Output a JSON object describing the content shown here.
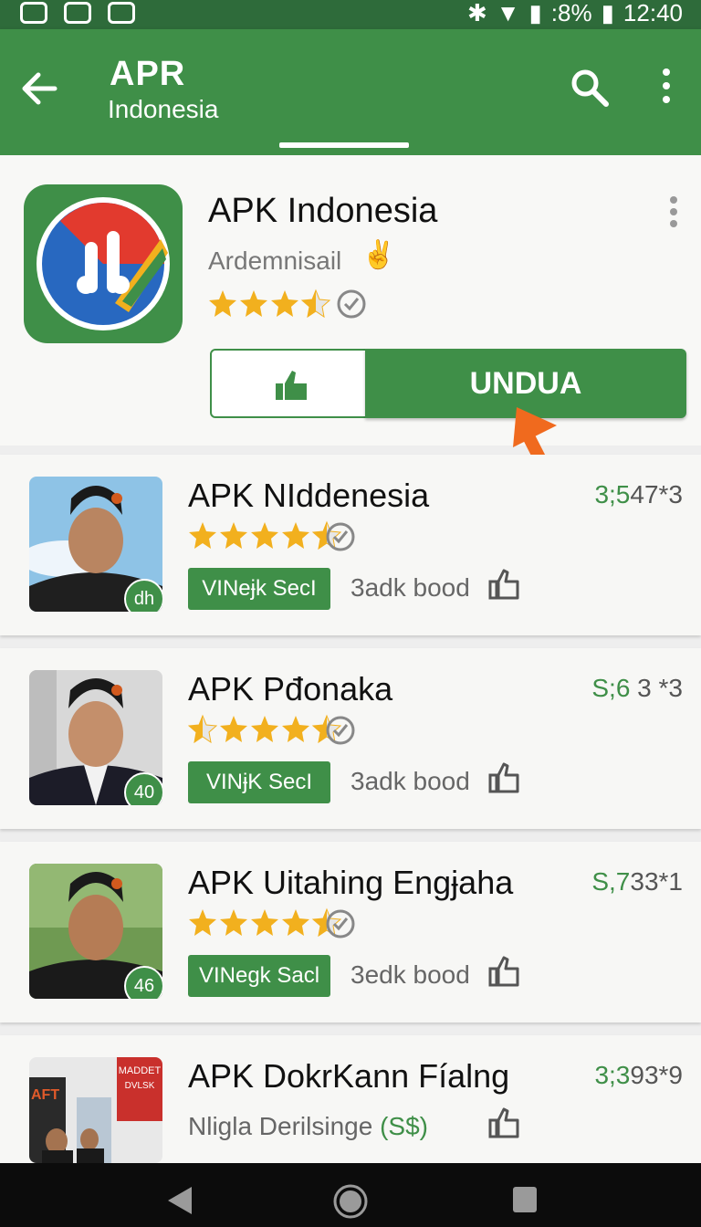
{
  "status_bar": {
    "battery": ":8%",
    "time": "12:40"
  },
  "app_bar": {
    "title": "APR",
    "subtitle": "Indonesia"
  },
  "featured": {
    "title": "APK Indonesia",
    "developer": "Ardemnisail",
    "rating": 3.5,
    "download_label": "UNDUA"
  },
  "apps": [
    {
      "title": "APK NIddenesia",
      "price": "3;547*3",
      "price_green": "3;5",
      "price_rest": "47*3",
      "rating": 4.5,
      "chip": "VINeɉk SecI",
      "meta": "3adk bood",
      "badge": "dh"
    },
    {
      "title": "APK Pđonaka",
      "price": "S;6 3 *3",
      "price_green": "S;6",
      "price_rest": " 3 *3",
      "rating": 4.5,
      "chip": "VINɉK SecI",
      "meta": "3adk bood",
      "badge": "40"
    },
    {
      "title": "APK Uitahing Engɉaha",
      "price": "S,733*1",
      "price_green": "S,7",
      "price_rest": "33*1",
      "rating": 4.5,
      "chip": "VINegk Sacl",
      "meta": "3edk bood",
      "badge": "46"
    },
    {
      "title": "APK DokrKann Fíalng",
      "price": "3;393*9",
      "price_green": "3;3",
      "price_rest": "93*9",
      "subtitle": "Nligla Derilsinge",
      "subtitle_tag": "(S$)",
      "sign_top": "MADDET",
      "sign_bottom": "DVLSK",
      "sign_left": "AFT"
    }
  ],
  "colors": {
    "primary": "#3f8f48",
    "status_bar": "#2e6b3a",
    "accent_arrow": "#f06a1e",
    "star": "#f2b01e"
  }
}
